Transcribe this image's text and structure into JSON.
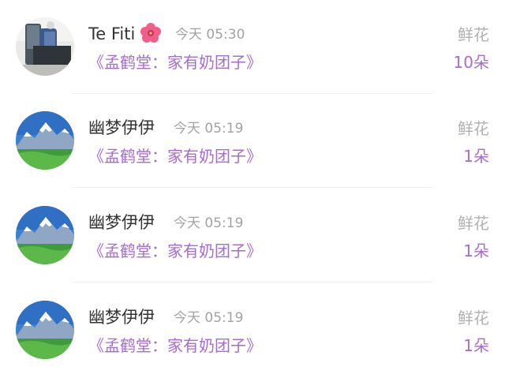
{
  "records": [
    {
      "user": "Te Fiti",
      "user_badge": "hibiscus-flower-icon",
      "time": "今天 05:30",
      "work": "《孟鹤堂：家有奶团子》",
      "gift_type": "鲜花",
      "gift_count": "10朵",
      "avatar": "photo-avatar"
    },
    {
      "user": "幽梦伊伊",
      "time": "今天 05:19",
      "work": "《孟鹤堂：家有奶团子》",
      "gift_type": "鲜花",
      "gift_count": "1朵",
      "avatar": "mountain-landscape-avatar"
    },
    {
      "user": "幽梦伊伊",
      "time": "今天 05:19",
      "work": "《孟鹤堂：家有奶团子》",
      "gift_type": "鲜花",
      "gift_count": "1朵",
      "avatar": "mountain-landscape-avatar"
    },
    {
      "user": "幽梦伊伊",
      "time": "今天 05:19",
      "work": "《孟鹤堂：家有奶团子》",
      "gift_type": "鲜花",
      "gift_count": "1朵",
      "avatar": "mountain-landscape-avatar"
    }
  ],
  "colors": {
    "accent": "#a66cd6",
    "primary_text": "#333333",
    "secondary_text": "#a3a3a3",
    "divider": "#efefef"
  }
}
